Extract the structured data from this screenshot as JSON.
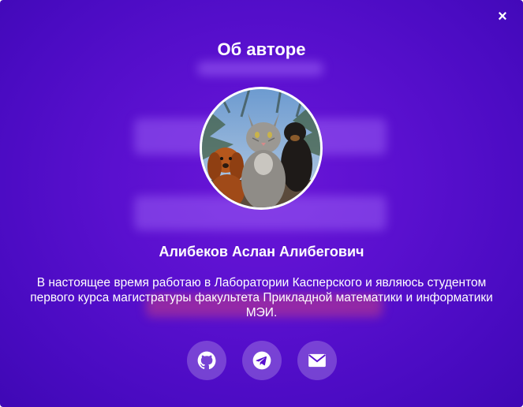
{
  "modal": {
    "close_icon": "×",
    "title": "Об авторе",
    "author_name": "Алибеков Аслан Алибегович",
    "bio": "В настоящее время работаю в Лаборатории Касперского и являюсь студентом первого курса магистратуры факультета Прикладной математики и информатики МЭИ.",
    "avatar": "cat-and-dogs-photo",
    "socials": [
      {
        "icon": "github-icon"
      },
      {
        "icon": "telegram-icon"
      },
      {
        "icon": "mail-icon"
      }
    ]
  },
  "colors": {
    "background": "#5a10cf",
    "text": "#ffffff"
  }
}
